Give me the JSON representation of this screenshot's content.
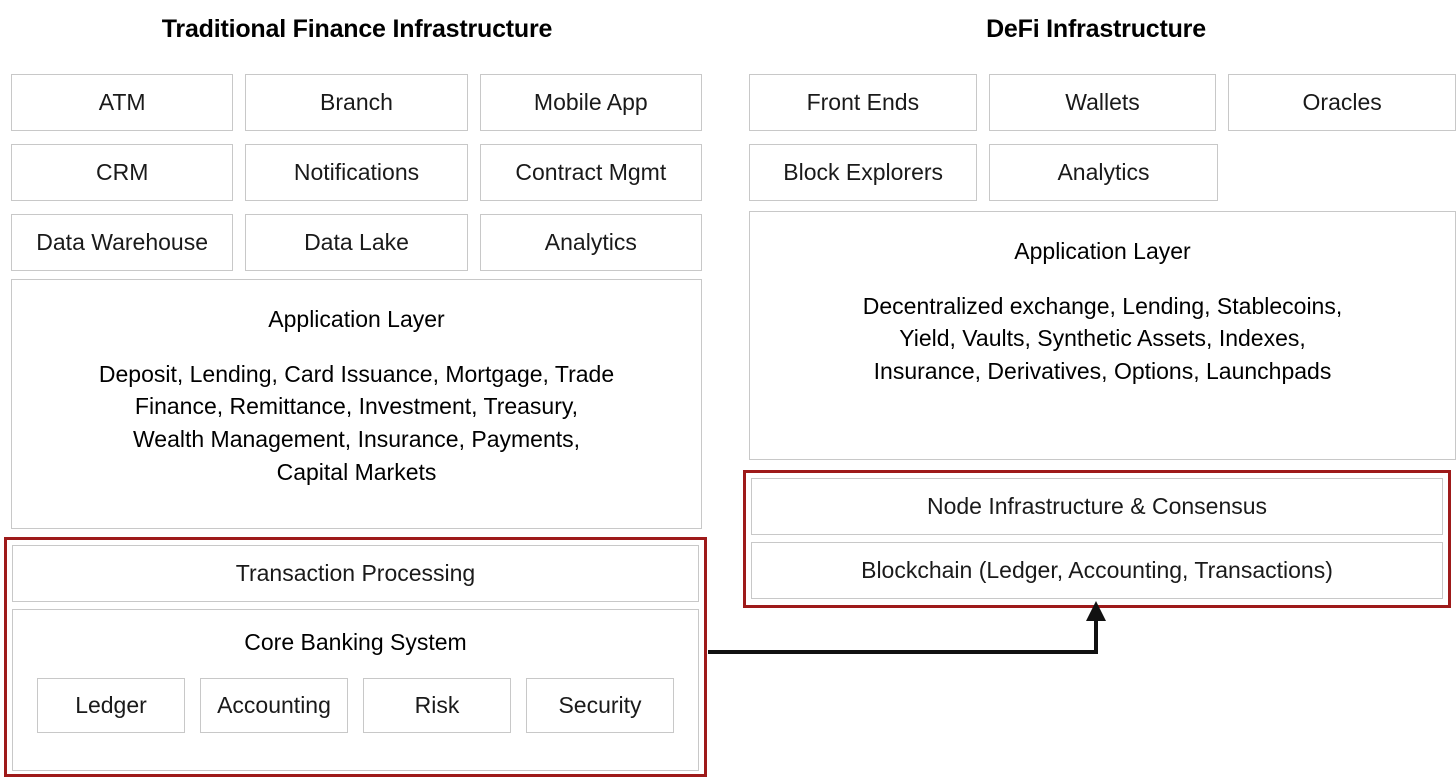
{
  "diagram": {
    "title_left": "Traditional Finance Infrastructure",
    "title_right": "DeFi Infrastructure",
    "accent_red": "#9e1a1a",
    "box_border": "#c8c8c8"
  },
  "left": {
    "title": "Traditional Finance Infrastructure",
    "tiles": [
      [
        "ATM",
        "Branch",
        "Mobile App"
      ],
      [
        "CRM",
        "Notifications",
        "Contract Mgmt"
      ],
      [
        "Data Warehouse",
        "Data Lake",
        "Analytics"
      ]
    ],
    "application_layer": {
      "heading": "Application Layer",
      "body": "Deposit, Lending, Card Issuance, Mortgage, Trade\nFinance, Remittance, Investment, Treasury,\nWealth Management, Insurance, Payments,\nCapital Markets"
    },
    "core_group": {
      "transaction_processing": "Transaction Processing",
      "core_banking_heading": "Core Banking System",
      "core_banking_items": [
        "Ledger",
        "Accounting",
        "Risk",
        "Security"
      ]
    }
  },
  "right": {
    "title": "DeFi Infrastructure",
    "tiles": [
      [
        "Front Ends",
        "Wallets",
        "Oracles"
      ],
      [
        "Block Explorers",
        "Analytics",
        ""
      ]
    ],
    "application_layer": {
      "heading": "Application Layer",
      "body": "Decentralized exchange, Lending, Stablecoins,\nYield, Vaults, Synthetic Assets, Indexes,\nInsurance, Derivatives, Options, Launchpads"
    },
    "core_group": {
      "node_infrastructure": "Node Infrastructure & Consensus",
      "blockchain": "Blockchain (Ledger, Accounting, Transactions)"
    }
  },
  "connector": {
    "description": "arrow from Core Banking System to Blockchain layer"
  }
}
